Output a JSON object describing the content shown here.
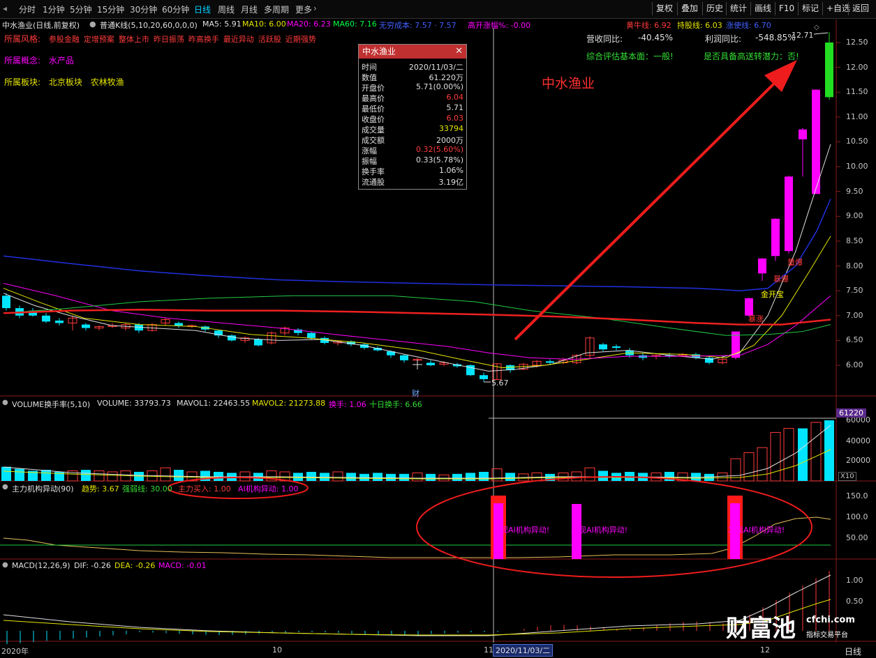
{
  "toolbar": {
    "periods": [
      "分时",
      "1分钟",
      "5分钟",
      "15分钟",
      "30分钟",
      "60分钟",
      "日线",
      "周线",
      "月线",
      "多周期",
      "更多"
    ],
    "active_period": "日线",
    "right_buttons": [
      "复权",
      "叠加",
      "历史",
      "统计",
      "画线",
      "F10",
      "标记",
      "+自选",
      "返回"
    ]
  },
  "info_line": {
    "title": "中水渔业(日线,前复权)",
    "kline": "普通K线(5,10,20,60,0,0,0)",
    "ma5": "MA5: 5.91",
    "ma10": "MA10: 6.00",
    "ma20": "MA20: 6.23",
    "ma60": "MA60: 7.16",
    "cost": "无穷成本: 7.57 · 7.57",
    "gap": "高开涨幅%: -0.00",
    "bull": "黄牛线: 6.92",
    "hold": "持股线: 6.03",
    "quick": "涨使线: 6.70"
  },
  "stock_style": {
    "label": "所属风格:",
    "tags": [
      "参股金融",
      "定增预案",
      "整体上市",
      "昨日振荡",
      "昨高换手",
      "最近异动",
      "活跃股",
      "近期强势"
    ]
  },
  "stock_concept": {
    "label": "所属概念:",
    "value": "水产品"
  },
  "stock_sector": {
    "label": "所属板块:",
    "values": [
      "北京板块",
      "农林牧渔"
    ]
  },
  "fundamentals": {
    "rev_label": "营收同比:",
    "rev_value": "-40.45%",
    "profit_label": "利润同比:",
    "profit_value": "-548.85%",
    "eval": "综合评估基本面：一般!",
    "transfer": "是否具备高送转潜力：否!"
  },
  "annotation_title": "中水渔业",
  "price_labels": {
    "high": "12.71",
    "low": "5.67",
    "cai": "财",
    "signals": [
      "暴涨",
      "金开宝",
      "暴爆",
      "量爆"
    ]
  },
  "tooltip": {
    "title": "中水渔业",
    "rows": [
      {
        "k": "时间",
        "v": "2020/11/03/二",
        "c": "#e0e0e0"
      },
      {
        "k": "数值",
        "v": "61.220万",
        "c": "#e0e0e0"
      },
      {
        "k": "开盘价",
        "v": "5.71(0.00%)",
        "c": "#e0e0e0"
      },
      {
        "k": "最高价",
        "v": "6.04",
        "c": "#ff3b3b"
      },
      {
        "k": "最低价",
        "v": "5.71",
        "c": "#e0e0e0"
      },
      {
        "k": "收盘价",
        "v": "6.03",
        "c": "#ff3b3b"
      },
      {
        "k": "成交量",
        "v": "33794",
        "c": "#e5e500"
      },
      {
        "k": "成交额",
        "v": "2000万",
        "c": "#e0e0e0"
      },
      {
        "k": "涨幅",
        "v": "0.32(5.60%)",
        "c": "#ff3b3b"
      },
      {
        "k": "振幅",
        "v": "0.33(5.78%)",
        "c": "#e0e0e0"
      },
      {
        "k": "换手率",
        "v": "1.06%",
        "c": "#e0e0e0"
      },
      {
        "k": "流通股",
        "v": "3.19亿",
        "c": "#e0e0e0"
      }
    ]
  },
  "price_axis": [
    "12.50",
    "12.00",
    "11.50",
    "11.00",
    "10.50",
    "10.00",
    "9.50",
    "9.00",
    "8.50",
    "8.00",
    "7.50",
    "7.00",
    "6.50",
    "6.00"
  ],
  "volume_panel": {
    "header": "VOLUME换手率(5,10)",
    "volume": "VOLUME: 33793.73",
    "mavol1": "MAVOL1: 22463.55",
    "mavol2": "MAVOL2: 21273.88",
    "turnover": "换手: 1.06",
    "ten_day": "十日换手: 6.66",
    "axis": [
      "60000",
      "40000",
      "20000"
    ],
    "top_value": "61220",
    "unit": "X10"
  },
  "main_force_panel": {
    "header": "主力机构异动(90)",
    "trend": "趋势: 3.67",
    "strong": "强弱线: 30.00",
    "buy": "主力买入: 1.00",
    "ai": "AI机构异动: 1.00",
    "alert": "发现AI机构异动!",
    "axis": [
      "150.0",
      "100.0",
      "50.00"
    ]
  },
  "macd_panel": {
    "header": "MACD(12,26,9)",
    "dif": "DIF: -0.26",
    "dea": "DEA: -0.26",
    "macd": "MACD: -0.01",
    "axis": [
      "1.00",
      "0.50"
    ]
  },
  "date_axis": {
    "year": "2020年",
    "m10": "10",
    "m11": "11",
    "m12": "12",
    "cursor": "2020/11/03/二",
    "period": "日线"
  },
  "watermark": {
    "name": "财富池",
    "url": "cfchi.com",
    "slogan": "指标交易平台"
  },
  "colors": {
    "up": "#ff3b3b",
    "down": "#00e5ff",
    "surge": "#ff00ff",
    "ai_alert": "#ff00ff",
    "bg": "#000000"
  }
}
